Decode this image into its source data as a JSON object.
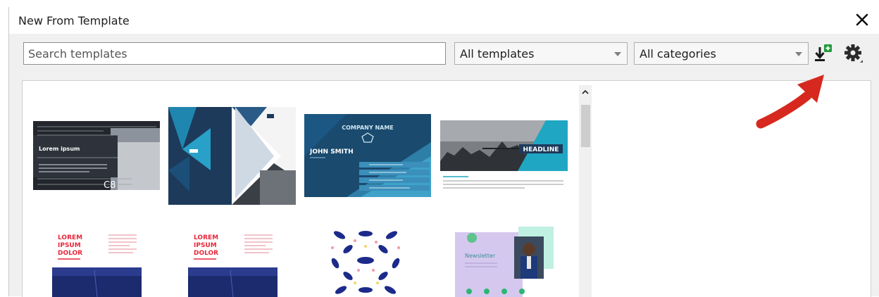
{
  "dialog": {
    "title": "New From Template",
    "close_label": "✕"
  },
  "toolbar": {
    "search": {
      "placeholder": "Search templates",
      "value": ""
    },
    "template_filter": {
      "selected": "All templates"
    },
    "category_filter": {
      "selected": "All categories"
    },
    "icons": [
      "download-template-icon",
      "gear-icon"
    ]
  },
  "templates": [
    {
      "name": "tech-document",
      "texts": [
        "Lorem ipsum",
        "C8"
      ]
    },
    {
      "name": "blue-brochure",
      "texts": []
    },
    {
      "name": "business-card",
      "texts": [
        "COMPANY NAME",
        "JOHN SMITH"
      ]
    },
    {
      "name": "headline-flyer",
      "texts": [
        "HEADLINE"
      ]
    },
    {
      "name": "lorem-poster-1",
      "texts": [
        "LOREM",
        "IPSUM",
        "DOLOR"
      ]
    },
    {
      "name": "lorem-poster-2",
      "texts": [
        "LOREM",
        "IPSUM",
        "DOLOR"
      ]
    },
    {
      "name": "pattern-design",
      "texts": []
    },
    {
      "name": "newsletter",
      "texts": [
        "Newsletter"
      ]
    }
  ],
  "colors": {
    "accent_arrow": "#d6281e",
    "navy": "#1d3a5b",
    "teal": "#1fa6c2",
    "red_text": "#e8273a"
  }
}
